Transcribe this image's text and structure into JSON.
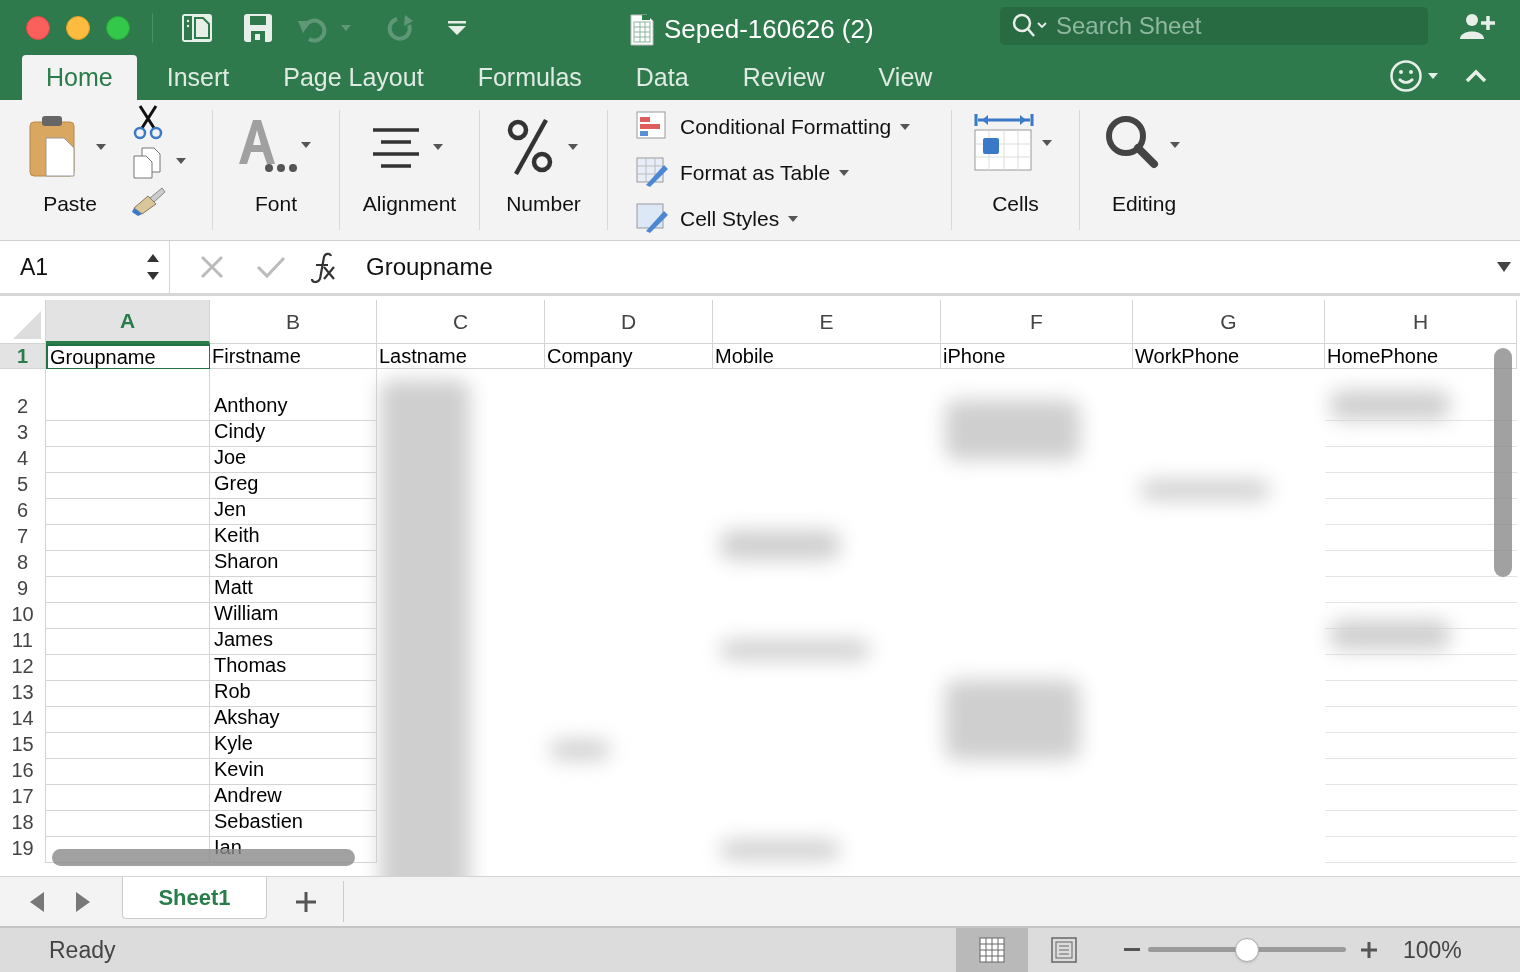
{
  "window": {
    "title": "Seped-160626 (2)"
  },
  "search": {
    "placeholder": "Search Sheet"
  },
  "tabs": [
    {
      "label": "Home",
      "selected": true
    },
    {
      "label": "Insert",
      "selected": false
    },
    {
      "label": "Page Layout",
      "selected": false
    },
    {
      "label": "Formulas",
      "selected": false
    },
    {
      "label": "Data",
      "selected": false
    },
    {
      "label": "Review",
      "selected": false
    },
    {
      "label": "View",
      "selected": false
    }
  ],
  "ribbon": {
    "paste": "Paste",
    "font": "Font",
    "alignment": "Alignment",
    "number": "Number",
    "styles": [
      {
        "kind": "conditional",
        "label": "Conditional Formatting"
      },
      {
        "kind": "table",
        "label": "Format as Table"
      },
      {
        "kind": "cell",
        "label": "Cell Styles"
      }
    ],
    "cells": "Cells",
    "editing": "Editing"
  },
  "formula_bar": {
    "name_box": "A1",
    "formula": "Groupname"
  },
  "columns": [
    {
      "label": "A",
      "selected": true
    },
    {
      "label": "B",
      "selected": false
    },
    {
      "label": "C",
      "selected": false
    },
    {
      "label": "D",
      "selected": false
    },
    {
      "label": "E",
      "selected": false
    },
    {
      "label": "F",
      "selected": false
    },
    {
      "label": "G",
      "selected": false
    },
    {
      "label": "H",
      "selected": false
    }
  ],
  "header_row": {
    "number": "1",
    "selected": true,
    "cells": [
      {
        "text": "Groupname",
        "selected": true
      },
      {
        "text": "Firstname",
        "selected": false
      },
      {
        "text": "Lastname",
        "selected": false
      },
      {
        "text": "Company",
        "selected": false
      },
      {
        "text": "Mobile",
        "selected": false
      },
      {
        "text": "iPhone",
        "selected": false
      },
      {
        "text": "WorkPhone",
        "selected": false
      },
      {
        "text": "HomePhone",
        "selected": false
      }
    ]
  },
  "rows": [
    {
      "number": "2",
      "firstname": "Anthony"
    },
    {
      "number": "3",
      "firstname": "Cindy"
    },
    {
      "number": "4",
      "firstname": "Joe"
    },
    {
      "number": "5",
      "firstname": "Greg"
    },
    {
      "number": "6",
      "firstname": "Jen"
    },
    {
      "number": "7",
      "firstname": "Keith"
    },
    {
      "number": "8",
      "firstname": "Sharon"
    },
    {
      "number": "9",
      "firstname": "Matt"
    },
    {
      "number": "10",
      "firstname": "William"
    },
    {
      "number": "11",
      "firstname": "James"
    },
    {
      "number": "12",
      "firstname": "Thomas"
    },
    {
      "number": "13",
      "firstname": "Rob"
    },
    {
      "number": "14",
      "firstname": "Akshay"
    },
    {
      "number": "15",
      "firstname": "Kyle"
    },
    {
      "number": "16",
      "firstname": "Kevin"
    },
    {
      "number": "17",
      "firstname": "Andrew"
    },
    {
      "number": "18",
      "firstname": "Sebastien"
    },
    {
      "number": "19",
      "firstname": "Ian"
    }
  ],
  "sheet_tabs": [
    {
      "label": "Sheet1",
      "selected": true
    }
  ],
  "status_bar": {
    "status": "Ready",
    "views": [
      {
        "kind": "normal",
        "selected": true
      },
      {
        "kind": "page_layout",
        "selected": false
      }
    ],
    "zoom": {
      "level": 0.5,
      "reading": "100%"
    }
  }
}
